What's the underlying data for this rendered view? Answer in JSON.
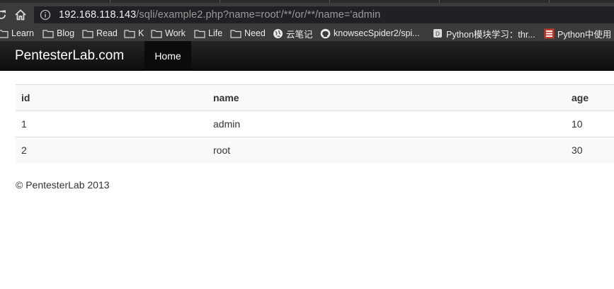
{
  "browser": {
    "url_host": "192.168.118.143",
    "url_path": "/sqli/example2.php?name=root'/**/or/**/name='admin",
    "bookmarks": [
      {
        "label": "Learn",
        "icon": "folder-icon"
      },
      {
        "label": "Blog",
        "icon": "folder-icon"
      },
      {
        "label": "Read",
        "icon": "folder-icon"
      },
      {
        "label": "K",
        "icon": "folder-icon"
      },
      {
        "label": "Work",
        "icon": "folder-icon"
      },
      {
        "label": "Life",
        "icon": "folder-icon"
      },
      {
        "label": "Need",
        "icon": "folder-icon"
      },
      {
        "label": "云笔记",
        "icon": "globe-icon"
      },
      {
        "label": "knowsecSpider2/spi...",
        "icon": "github-icon"
      },
      {
        "label": "Python模块学习：thr...",
        "icon": "page-icon"
      },
      {
        "label": "Python中使用",
        "icon": "bookmark-red-icon"
      }
    ]
  },
  "navbar": {
    "brand": "PentesterLab.com",
    "home": "Home"
  },
  "table": {
    "headers": [
      "id",
      "name",
      "age"
    ],
    "rows": [
      [
        "1",
        "admin",
        "10"
      ],
      [
        "2",
        "root",
        "30"
      ]
    ]
  },
  "footer": {
    "text": "© PentesterLab 2013"
  },
  "colors": {
    "chrome": "#3b3b3b",
    "navbar": "#1b1b1b",
    "stripe": "#f9f9f9"
  }
}
